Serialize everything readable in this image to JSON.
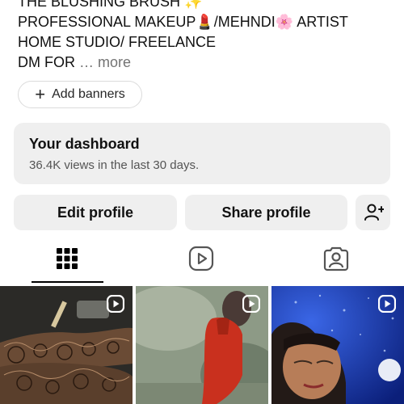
{
  "profile": {
    "bio_lines": [
      "THE BLUSHING BRUSH ✨",
      "PROFESSIONAL MAKEUP💄/MEHNDI🌸 ARTIST",
      "HOME STUDIO/ FREELANCE"
    ],
    "bio_last": "DM FOR",
    "more_label": "… more"
  },
  "banners": {
    "icon": "plus-icon",
    "label": "Add banners"
  },
  "dashboard": {
    "title": "Your dashboard",
    "subtitle": "36.4K views in the last 30 days."
  },
  "actions": {
    "edit_label": "Edit profile",
    "share_label": "Share profile",
    "add_user_icon": "add-user-icon"
  },
  "tabs": [
    {
      "icon": "grid-icon",
      "active": true
    },
    {
      "icon": "reels-icon",
      "active": false
    },
    {
      "icon": "tagged-icon",
      "active": false
    }
  ],
  "posts": [
    {
      "type": "reel",
      "subject": "mehndi-hands"
    },
    {
      "type": "reel",
      "subject": "person-in-red"
    },
    {
      "type": "reel",
      "subject": "makeup-portrait"
    }
  ]
}
